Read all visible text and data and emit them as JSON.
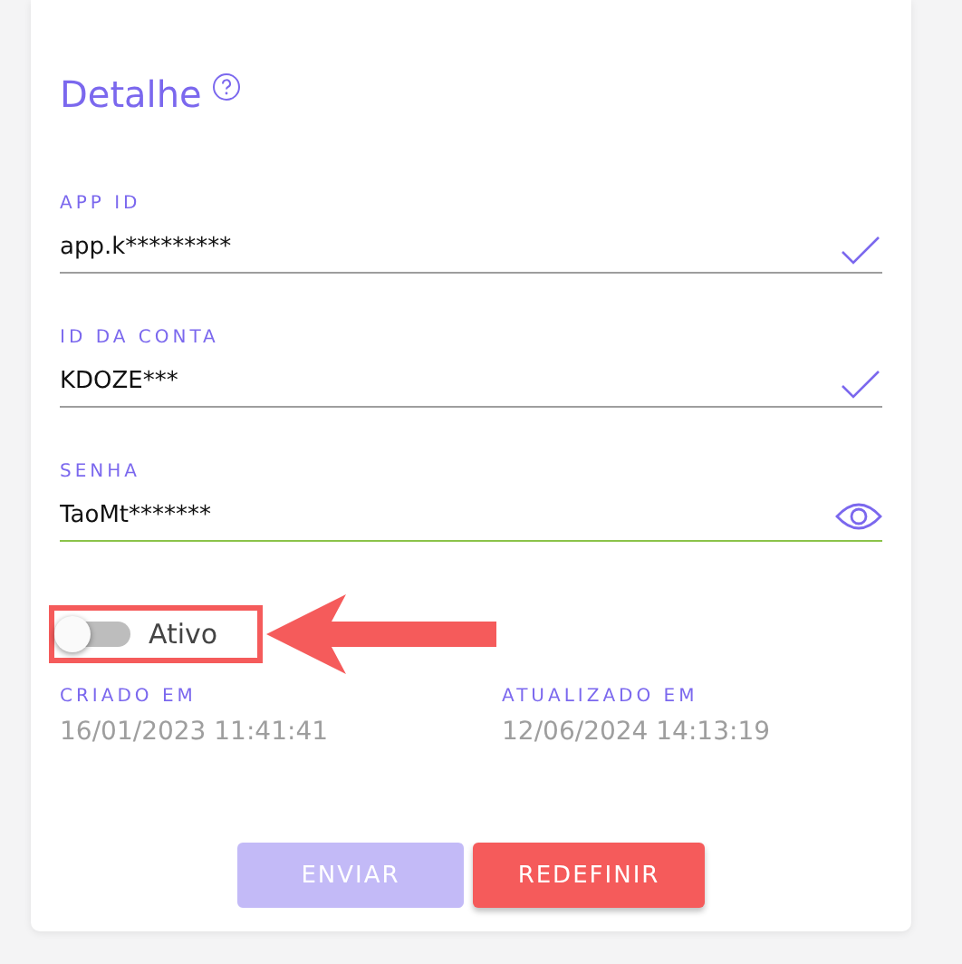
{
  "title": "Detalhe",
  "fields": [
    {
      "label": "APP ID",
      "value": "app.k*********",
      "kind": "check",
      "focused": false
    },
    {
      "label": "ID DA CONTA",
      "value": "KDOZE***",
      "kind": "check",
      "focused": false
    },
    {
      "label": "SENHA",
      "value": "TaoMt*******",
      "kind": "eye",
      "focused": true
    }
  ],
  "toggle": {
    "label": "Ativo",
    "on": false
  },
  "dates": [
    {
      "label": "CRIADO EM",
      "value": "16/01/2023 11:41:41"
    },
    {
      "label": "ATUALIZADO EM",
      "value": "12/06/2024 14:13:19"
    }
  ],
  "buttons": [
    {
      "label": "ENVIAR",
      "kind": "primary",
      "disabled": true
    },
    {
      "label": "REDEFINIR",
      "kind": "danger",
      "disabled": false
    }
  ]
}
